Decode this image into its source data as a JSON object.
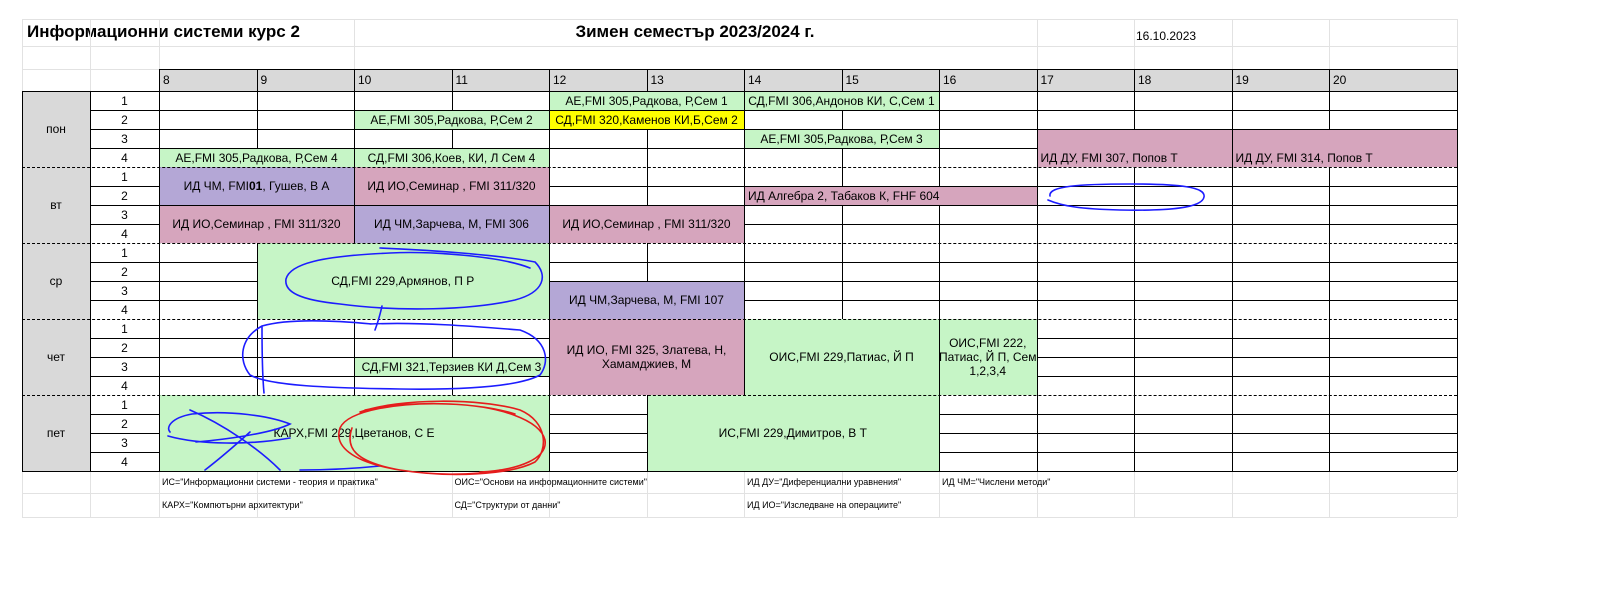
{
  "sheet": {
    "title": "Информационни системи курс 2",
    "semester": "Зимен семестър 2023/2024 г.",
    "date": "16.10.2023",
    "hours": [
      "8",
      "9",
      "10",
      "11",
      "12",
      "13",
      "14",
      "15",
      "16",
      "17",
      "18",
      "19",
      "20"
    ],
    "days": [
      {
        "label": "пон",
        "rows": [
          "1",
          "2",
          "3",
          "4"
        ]
      },
      {
        "label": "вт",
        "rows": [
          "1",
          "2",
          "3",
          "4"
        ]
      },
      {
        "label": "ср",
        "rows": [
          "1",
          "2",
          "3",
          "4"
        ]
      },
      {
        "label": "чет",
        "rows": [
          "1",
          "2",
          "3",
          "4"
        ]
      },
      {
        "label": "пет",
        "rows": [
          "1",
          "2",
          "3",
          "4"
        ]
      }
    ],
    "events": [
      {
        "html": "АЕ,FMI 305,Радкова, Р,Сем 1",
        "col": 4,
        "span": 2,
        "row": 0,
        "rows": 1,
        "color": "#c6f5c6"
      },
      {
        "html": "СД,FMI 306,Андонов КИ, С,Сем 1",
        "col": 6,
        "span": 2,
        "row": 0,
        "rows": 1,
        "color": "#c6f5c6"
      },
      {
        "html": "АЕ,FMI 305,Радкова, Р,Сем 2",
        "col": 2,
        "span": 2,
        "row": 1,
        "rows": 1,
        "color": "#c6f5c6"
      },
      {
        "html": "СД,FMI 320,Каменов КИ,Б,Сем 2",
        "col": 4,
        "span": 2,
        "row": 1,
        "rows": 1,
        "color": "#ffff00"
      },
      {
        "html": "АЕ,FMI 305,Радкова, Р,Сем 3",
        "col": 6,
        "span": 2,
        "row": 2,
        "rows": 1,
        "color": "#c6f5c6"
      },
      {
        "html": "ИД ДУ, FMI 307, Попов Т",
        "col": 9,
        "span": 2,
        "row": 2,
        "rows": 2,
        "color": "#d6a5bd",
        "align": "bottom-left"
      },
      {
        "html": "ИД ДУ, FMI 314, Попов Т",
        "col": 11,
        "span": 2,
        "row": 2,
        "rows": 2,
        "color": "#d6a5bd",
        "align": "bottom-left"
      },
      {
        "html": "АЕ,FMI 305,Радкова, Р,Сем 4",
        "col": 0,
        "span": 2,
        "row": 3,
        "rows": 1,
        "color": "#c6f5c6"
      },
      {
        "html": "СД,FMI 306,Коев, КИ, Л Сем 4",
        "col": 2,
        "span": 2,
        "row": 3,
        "rows": 1,
        "color": "#c6f5c6"
      },
      {
        "html": "ИД ЧМ, FMI <b>01</b>, Гушев, В А",
        "col": 0,
        "span": 2,
        "row": 4,
        "rows": 2,
        "color": "#b4a7d6"
      },
      {
        "html": "ИД ИО,Семинар , FMI 311/320",
        "col": 2,
        "span": 2,
        "row": 4,
        "rows": 2,
        "color": "#d6a5bd"
      },
      {
        "html": "ИД Алгебра 2, Табаков К, FHF 604",
        "col": 6,
        "span": 3,
        "row": 5,
        "rows": 1,
        "color": "#d6a5bd",
        "align": "left"
      },
      {
        "html": "ИД ИО,Семинар , FMI 311/320",
        "col": 0,
        "span": 2,
        "row": 6,
        "rows": 2,
        "color": "#d6a5bd"
      },
      {
        "html": "ИД ЧМ,Зарчева, М, FMI 306",
        "col": 2,
        "span": 2,
        "row": 6,
        "rows": 2,
        "color": "#b4a7d6"
      },
      {
        "html": "ИД ИО,Семинар , FMI 311/320",
        "col": 4,
        "span": 2,
        "row": 6,
        "rows": 2,
        "color": "#d6a5bd"
      },
      {
        "html": "СД,FMI 229,Армянов, П Р",
        "col": 1,
        "span": 3,
        "row": 8,
        "rows": 4,
        "color": "#c6f5c6"
      },
      {
        "html": "ИД ЧМ,Зарчева, М, FMI 107",
        "col": 4,
        "span": 2,
        "row": 10,
        "rows": 2,
        "color": "#b4a7d6"
      },
      {
        "html": "ИД ИО, FMI 325, Златева, Н, Хамамджиев, М",
        "col": 4,
        "span": 2,
        "row": 12,
        "rows": 4,
        "color": "#d6a5bd"
      },
      {
        "html": "ОИС,FMI 229,Патиас, Й П",
        "col": 6,
        "span": 2,
        "row": 12,
        "rows": 4,
        "color": "#c6f5c6"
      },
      {
        "html": "ОИС,FMI 222, Патиас, Й П, Сем 1,2,3,4",
        "col": 8,
        "span": 1,
        "row": 12,
        "rows": 4,
        "color": "#c6f5c6"
      },
      {
        "html": "СД,FMI 321,Терзиев КИ Д,Сем 3",
        "col": 2,
        "span": 2,
        "row": 14,
        "rows": 1,
        "color": "#c6f5c6"
      },
      {
        "html": "КАРХ,FMI 229,Цветанов, С Е",
        "col": 0,
        "span": 4,
        "row": 16,
        "rows": 4,
        "color": "#c6f5c6"
      },
      {
        "html": "ИС,FMI 229,Димитров, В Т",
        "col": 5,
        "span": 3,
        "row": 16,
        "rows": 4,
        "color": "#c6f5c6"
      }
    ],
    "legend": [
      {
        "text": "ИС=\"Информационни системи - теория и практика\"",
        "col": 1,
        "line": 0
      },
      {
        "text": "ОИС=\"Основи на информационните системи\"",
        "col": 4,
        "line": 0
      },
      {
        "text": "ИД ДУ=\"Диференциални уравнения\"",
        "col": 7,
        "line": 0
      },
      {
        "text": "ИД ЧМ=\"Числени методи\"",
        "col": 9,
        "line": 0
      },
      {
        "text": "КАРХ=\"Компютърни архитектури\"",
        "col": 1,
        "line": 1
      },
      {
        "text": "СД=\"Структури от данни\"",
        "col": 4,
        "line": 1
      },
      {
        "text": "ИД ИО=\"Изследване на операциите\"",
        "col": 7,
        "line": 1
      }
    ],
    "colors": {
      "grid": "#000000",
      "light_grid": "#e2e2e2",
      "header": "#d9d9d9",
      "green": "#c6f5c6",
      "yellow": "#ffff00",
      "pink": "#d6a5bd",
      "purple": "#b4a7d6",
      "blue_ink": "#1c1cff",
      "red_ink": "#e51c1c"
    }
  }
}
